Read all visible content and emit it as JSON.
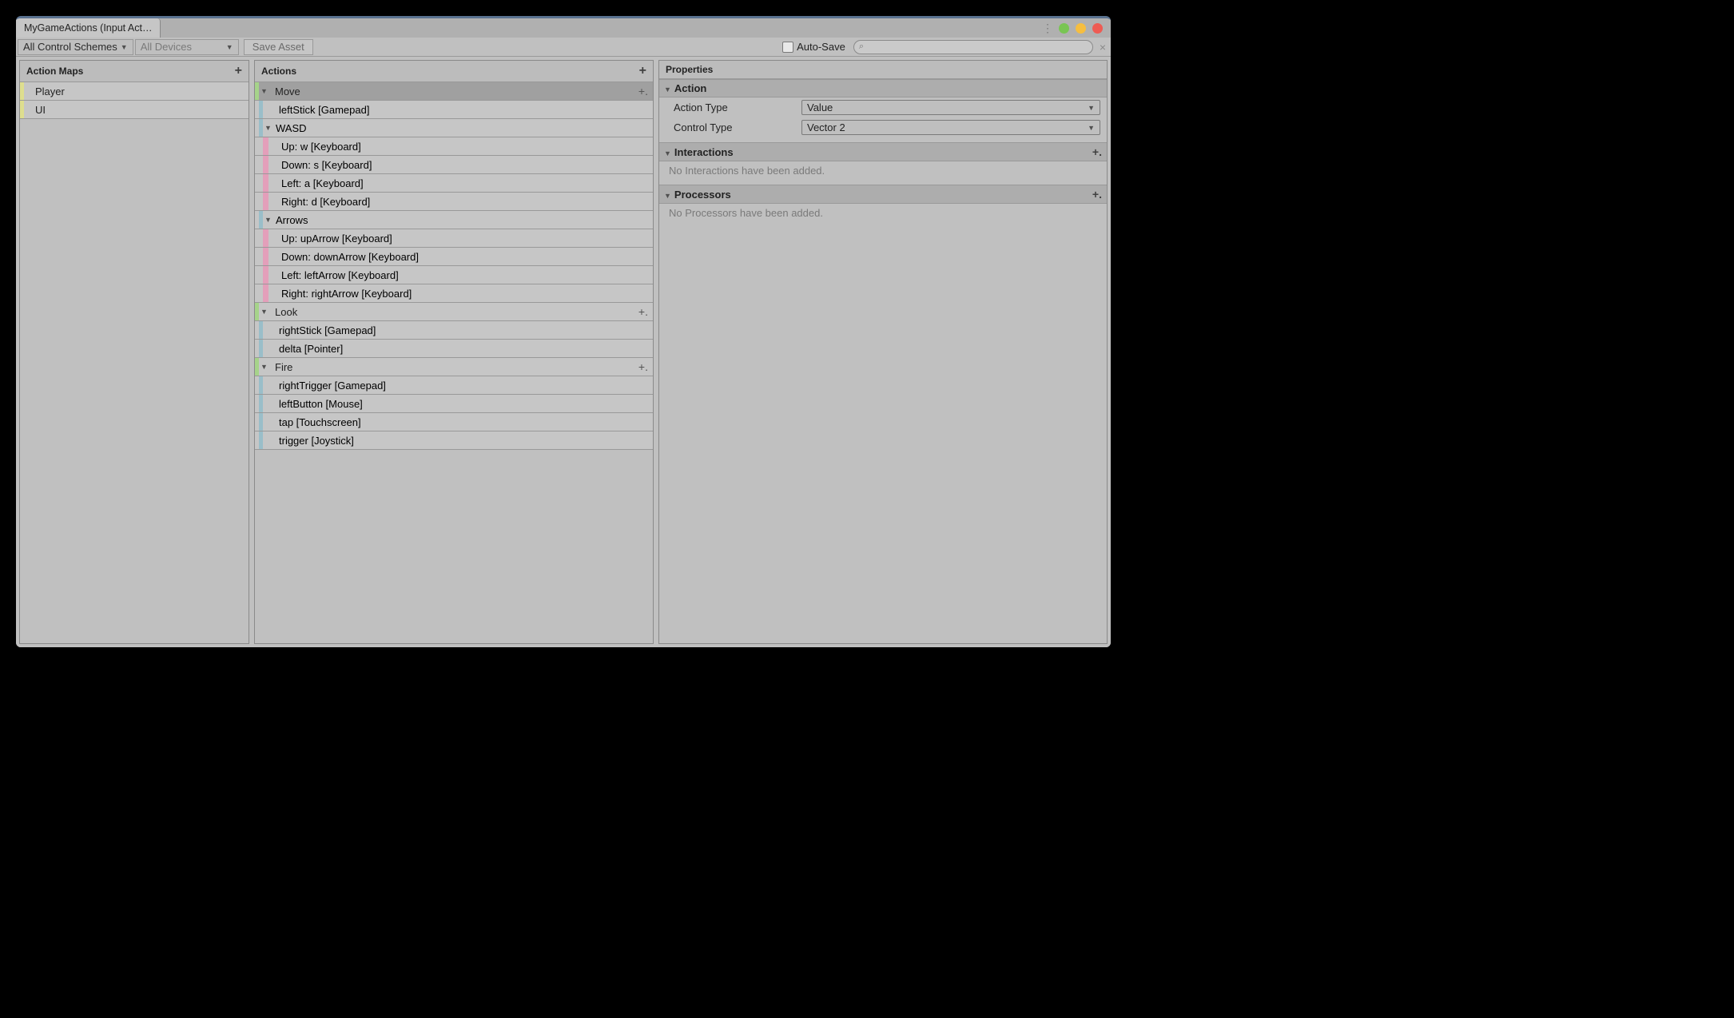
{
  "window": {
    "title": "MyGameActions (Input Act…"
  },
  "toolbar": {
    "scheme": "All Control Schemes",
    "devices": "All Devices",
    "save": "Save Asset",
    "autosave": "Auto-Save"
  },
  "panels": {
    "maps_header": "Action Maps",
    "actions_header": "Actions",
    "props_header": "Properties"
  },
  "maps": [
    "Player",
    "UI"
  ],
  "actions": [
    {
      "name": "Move",
      "selected": true,
      "children": [
        {
          "type": "binding",
          "label": "leftStick [Gamepad]",
          "stripe": "blue"
        },
        {
          "type": "composite",
          "label": "WASD",
          "stripe": "blue",
          "children": [
            {
              "label": "Up: w [Keyboard]",
              "stripe": "pink"
            },
            {
              "label": "Down: s [Keyboard]",
              "stripe": "pink"
            },
            {
              "label": "Left: a [Keyboard]",
              "stripe": "pink"
            },
            {
              "label": "Right: d [Keyboard]",
              "stripe": "pink"
            }
          ]
        },
        {
          "type": "composite",
          "label": "Arrows",
          "stripe": "blue",
          "children": [
            {
              "label": "Up: upArrow [Keyboard]",
              "stripe": "pink"
            },
            {
              "label": "Down: downArrow [Keyboard]",
              "stripe": "pink"
            },
            {
              "label": "Left: leftArrow [Keyboard]",
              "stripe": "pink"
            },
            {
              "label": "Right: rightArrow [Keyboard]",
              "stripe": "pink"
            }
          ]
        }
      ]
    },
    {
      "name": "Look",
      "children": [
        {
          "type": "binding",
          "label": "rightStick [Gamepad]",
          "stripe": "blue"
        },
        {
          "type": "binding",
          "label": "delta [Pointer]",
          "stripe": "blue"
        }
      ]
    },
    {
      "name": "Fire",
      "children": [
        {
          "type": "binding",
          "label": "rightTrigger [Gamepad]",
          "stripe": "blue"
        },
        {
          "type": "binding",
          "label": "leftButton [Mouse]",
          "stripe": "blue"
        },
        {
          "type": "binding",
          "label": "tap [Touchscreen]",
          "stripe": "blue"
        },
        {
          "type": "binding",
          "label": "trigger [Joystick]",
          "stripe": "blue"
        }
      ]
    }
  ],
  "properties": {
    "section_action": "Action",
    "action_type_label": "Action Type",
    "action_type_value": "Value",
    "control_type_label": "Control Type",
    "control_type_value": "Vector 2",
    "section_interactions": "Interactions",
    "interactions_empty": "No Interactions have been added.",
    "section_processors": "Processors",
    "processors_empty": "No Processors have been added."
  }
}
